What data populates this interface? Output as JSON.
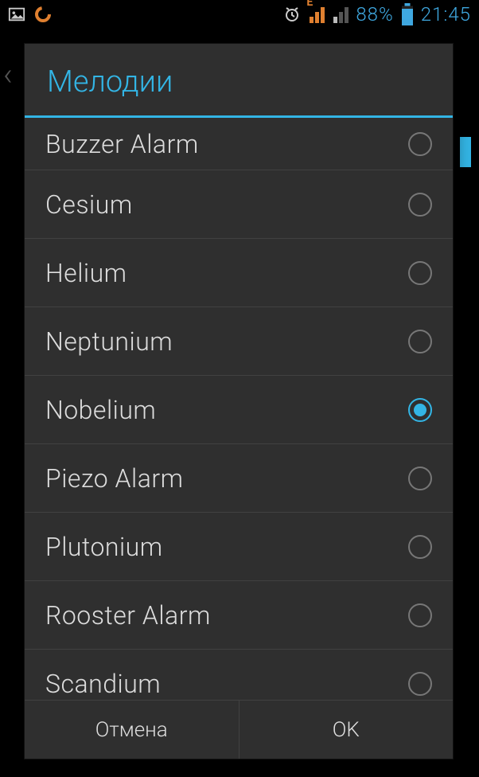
{
  "statusbar": {
    "network_tag": "E",
    "battery_percent": "88%",
    "time": "21:45"
  },
  "dialog": {
    "title": "Мелодии",
    "items": [
      {
        "label": "Buzzer Alarm",
        "selected": false
      },
      {
        "label": "Cesium",
        "selected": false
      },
      {
        "label": "Helium",
        "selected": false
      },
      {
        "label": "Neptunium",
        "selected": false
      },
      {
        "label": "Nobelium",
        "selected": true
      },
      {
        "label": "Piezo Alarm",
        "selected": false
      },
      {
        "label": "Plutonium",
        "selected": false
      },
      {
        "label": "Rooster Alarm",
        "selected": false
      },
      {
        "label": "Scandium",
        "selected": false
      }
    ],
    "cancel_label": "Отмена",
    "ok_label": "OK"
  }
}
